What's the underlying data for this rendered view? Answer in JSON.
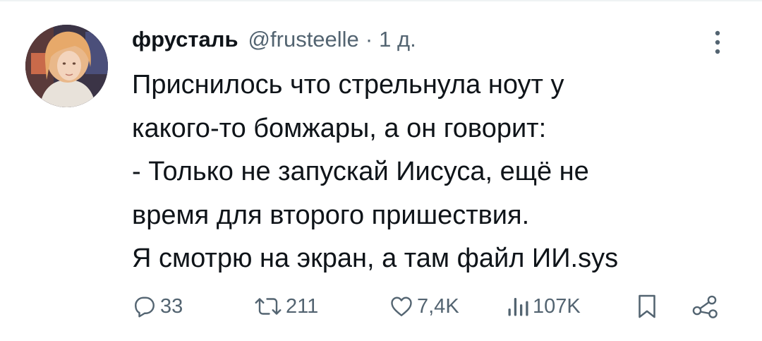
{
  "tweet": {
    "author": {
      "display_name": "фрусталь",
      "handle": "@frusteelle",
      "time": "1 д."
    },
    "separator": "·",
    "text_lines": [
      "Приснилось что стрельнула ноут у",
      "какого-то бомжары, а он говорит:",
      "- Только не запускай Иисуса, ещё не",
      "время для второго пришествия.",
      "Я смотрю на экран, а там файл ИИ.sys"
    ],
    "actions": {
      "reply": {
        "icon": "reply-icon",
        "count": "33"
      },
      "retweet": {
        "icon": "retweet-icon",
        "count": "211"
      },
      "like": {
        "icon": "heart-icon",
        "count": "7,4K"
      },
      "views": {
        "icon": "views-icon",
        "count": "107K"
      },
      "bookmark": {
        "icon": "bookmark-icon"
      },
      "share": {
        "icon": "share-icon"
      }
    },
    "colors": {
      "text": "#0f1419",
      "secondary": "#536471",
      "divider": "#eff3f4"
    }
  }
}
